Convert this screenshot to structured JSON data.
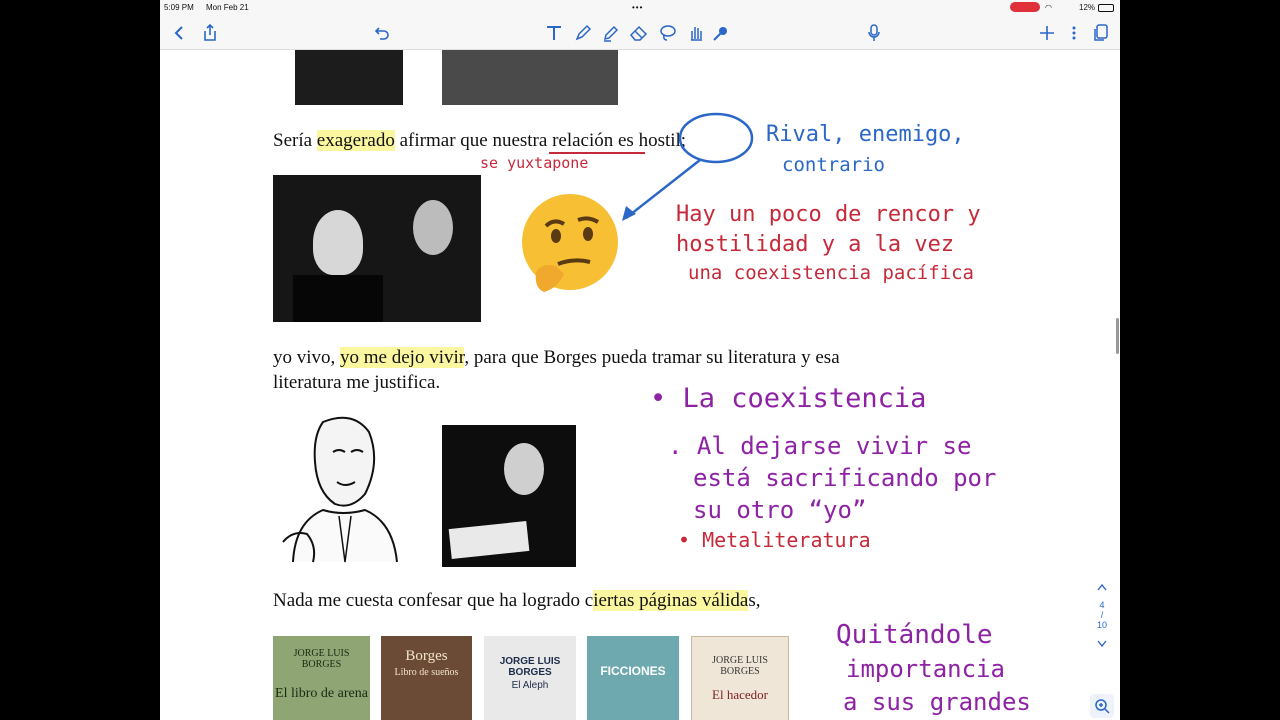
{
  "status": {
    "time": "5:09 PM",
    "date": "Mon Feb 21",
    "battery": "12%"
  },
  "toolbar": {
    "icons": [
      "back-icon",
      "share-icon",
      "undo-icon",
      "text-tool-icon",
      "pen-icon",
      "highlighter-icon",
      "eraser-icon",
      "lasso-icon",
      "hand-tool-icon",
      "magic-wand-icon",
      "mic-icon",
      "add-icon",
      "more-icon",
      "pages-icon"
    ]
  },
  "doc": {
    "p1_a": "Sería ",
    "p1_hl": "exagerado",
    "p1_b": " afirmar que nuestra relación es hostil;",
    "p2_a": "yo vivo, ",
    "p2_hl": "yo me dejo vivir",
    "p2_b": ", para que Borges pueda tramar su literatura y esa",
    "p2_c": "literatura me justifica.",
    "p3_a": "Nada me cuesta confesar que ha logrado c",
    "p3_hl": "iertas páginas válida",
    "p3_b": "s,"
  },
  "annotations": {
    "blue_1": "Rival, enemigo,",
    "blue_2": "contrario",
    "red_small": "se yuxtapone",
    "red_1": "Hay un poco de rencor y",
    "red_2": "hostilidad y a la vez",
    "red_3": "una coexistencia pacífica",
    "purple_1": "• La coexistencia",
    "purple_2": ". Al dejarse vivir se",
    "purple_3": "está sacrificando por",
    "purple_4": "su otro “yo”",
    "red_meta": "• Metaliteratura",
    "purple_5": "Quitándole",
    "purple_6": "importancia",
    "purple_7": "a sus grandes"
  },
  "books": [
    {
      "author": "JORGE LUIS BORGES",
      "title": "El libro de arena",
      "bg": "#8fa574"
    },
    {
      "author": "Borges",
      "title": "Libro de sueños",
      "bg": "#6b4a36"
    },
    {
      "author": "JORGE LUIS BORGES",
      "title": "El Aleph",
      "bg": "#e9e9e9"
    },
    {
      "author": "",
      "title": "FICCIONES",
      "bg": "#6fa9b0"
    },
    {
      "author": "JORGE LUIS BORGES",
      "title": "El hacedor",
      "bg": "#efe6d8"
    }
  ],
  "pager": {
    "current": "4",
    "total": "10"
  }
}
